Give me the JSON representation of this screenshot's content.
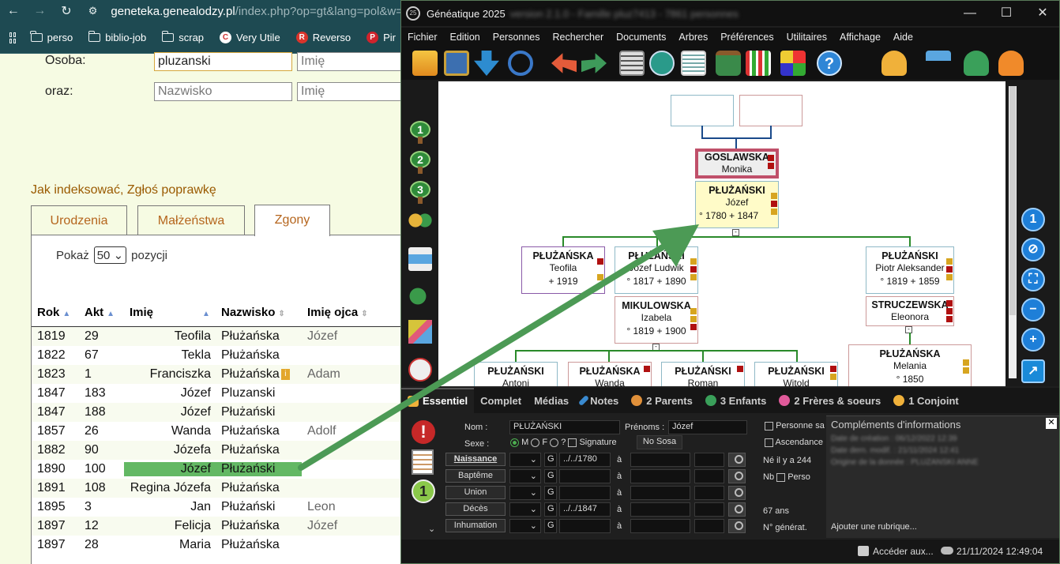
{
  "browser": {
    "url_host": "geneteka.genealodzy.pl",
    "url_rest": "/index.php?op=gt&lang=pol&w=",
    "bookmarks": [
      "perso",
      "biblio-job",
      "scrap",
      "Very Utile",
      "Reverso",
      "Pir"
    ],
    "form": {
      "osoba_label": "Osoba:",
      "oraz_label": "oraz:",
      "osoba_value": "pluzanski",
      "imie_placeholder": "Imię",
      "nazwisko_placeholder": "Nazwisko",
      "imie2_placeholder": "Imię"
    },
    "links": {
      "indeksowac": "Jak indeksować",
      "sep": ", ",
      "poprawke": "Zgłoś poprawkę"
    },
    "tabs": [
      "Urodzenia",
      "Małżeństwa",
      "Zgony"
    ],
    "pokaz": {
      "before": "Pokaż",
      "value": "50",
      "after": "pozycji"
    },
    "table": {
      "headers": [
        "Rok",
        "Akt",
        "Imię",
        "Nazwisko",
        "Imię ojca"
      ],
      "rows": [
        {
          "rok": "1819",
          "akt": "29",
          "imie": "Teofila",
          "nazwisko": "Płużańska",
          "ojca": "Józef"
        },
        {
          "rok": "1822",
          "akt": "67",
          "imie": "Tekla",
          "nazwisko": "Płużańska",
          "ojca": ""
        },
        {
          "rok": "1823",
          "akt": "1",
          "imie": "Franciszka",
          "nazwisko": "Płużańska",
          "ojca": "Adam"
        },
        {
          "rok": "1847",
          "akt": "183",
          "imie": "Józef",
          "nazwisko": "Pluzanski",
          "ojca": ""
        },
        {
          "rok": "1847",
          "akt": "188",
          "imie": "Józef",
          "nazwisko": "Płużański",
          "ojca": ""
        },
        {
          "rok": "1857",
          "akt": "26",
          "imie": "Wanda",
          "nazwisko": "Płużańska",
          "ojca": "Adolf"
        },
        {
          "rok": "1882",
          "akt": "90",
          "imie": "Józefa",
          "nazwisko": "Płużańska",
          "ojca": ""
        },
        {
          "rok": "1890",
          "akt": "100",
          "imie": "Józef",
          "nazwisko": "Płużański",
          "ojca": ""
        },
        {
          "rok": "1891",
          "akt": "108",
          "imie": "Regina Józefa",
          "nazwisko": "Płużańska",
          "ojca": ""
        },
        {
          "rok": "1895",
          "akt": "3",
          "imie": "Jan",
          "nazwisko": "Płużański",
          "ojca": "Leon"
        },
        {
          "rok": "1897",
          "akt": "12",
          "imie": "Felicja",
          "nazwisko": "Płużańska",
          "ojca": "Józef"
        },
        {
          "rok": "1897",
          "akt": "28",
          "imie": "Maria",
          "nazwisko": "Płużańska",
          "ojca": ""
        }
      ]
    }
  },
  "app": {
    "title": "Généatique 2025",
    "title_blurred": "version 2.1.0 - Famille pluz7413 - 7861 personnes",
    "menu": [
      "Fichier",
      "Edition",
      "Personnes",
      "Rechercher",
      "Documents",
      "Arbres",
      "Préférences",
      "Utilitaires",
      "Affichage",
      "Aide"
    ],
    "tree": {
      "goslawska": {
        "last": "GOSLAWSKA",
        "first": "Monika"
      },
      "jozef": {
        "last": "PŁUŻAŃSKI",
        "first": "Józef",
        "dates": "° 1780    + 1847"
      },
      "teofila": {
        "last": "PŁUŻAŃSKA",
        "first": "Teofila",
        "dates": "+ 1919"
      },
      "jozef_ludwik": {
        "last": "PŁUŻAŃSKI",
        "first": "Józef Ludwik",
        "dates": "° 1817    + 1890"
      },
      "piotr": {
        "last": "PŁUŻAŃSKI",
        "first": "Piotr Aleksander",
        "dates": "° 1819    + 1859"
      },
      "izabela": {
        "last": "MIKULOWSKA",
        "first": "Izabela",
        "dates": "° 1819    + 1900"
      },
      "eleonora": {
        "last": "STRUCZEWSKA",
        "first": "Eleonora"
      },
      "melania": {
        "last": "PŁUŻAŃSKA",
        "first": "Melania",
        "dates": "° 1850"
      },
      "antoni": {
        "last": "PŁUŻAŃSKI",
        "first": "Antoni"
      },
      "wanda": {
        "last": "PŁUŻAŃSKA",
        "first": "Wanda"
      },
      "roman": {
        "last": "PŁUŻAŃSKI",
        "first": "Roman"
      },
      "witold": {
        "last": "PŁUŻAŃSKI",
        "first": "Witold"
      }
    },
    "bottom_tabs": [
      "Essentiel",
      "Complet",
      "Médias",
      "Notes",
      "2 Parents",
      "3 Enfants",
      "2 Frères & soeurs",
      "1 Conjoint"
    ],
    "details": {
      "nom_label": "Nom :",
      "nom_value": "PŁUŻAŃSKI",
      "prenoms_label": "Prénoms :",
      "prenoms_value": "Józef",
      "sexe_label": "Sexe :",
      "m": "M",
      "f": "F",
      "q": "?",
      "signature": "Signature",
      "nosoba": "No Sosa",
      "personne": "Personne sa",
      "ascendance": "Ascendance",
      "events": [
        {
          "label": "Naissance",
          "g": "G",
          "date": "../../1780"
        },
        {
          "label": "Baptême",
          "g": "G",
          "date": ""
        },
        {
          "label": "Union",
          "g": "G",
          "date": ""
        },
        {
          "label": "Décès",
          "g": "G",
          "date": "../../1847"
        },
        {
          "label": "Inhumation",
          "g": "G",
          "date": ""
        }
      ],
      "a": "à",
      "ne_il_y_a": "Né il y a 244",
      "nb": "Nb",
      "perso": "Perso",
      "age": "67 ans",
      "generat": "N° générat."
    },
    "compl": {
      "title": "Compléments d'informations",
      "line1": "Date de création : 06/12/2022 12:39",
      "line2": "Date dern. modif. : 21/11/2024 12:41",
      "line3": "Origine de la donnée : PLUZANSKI ANNE",
      "add": "Ajouter une rubrique..."
    },
    "status": {
      "access": "Accéder aux...",
      "datetime": "21/11/2024 12:49:04"
    }
  }
}
